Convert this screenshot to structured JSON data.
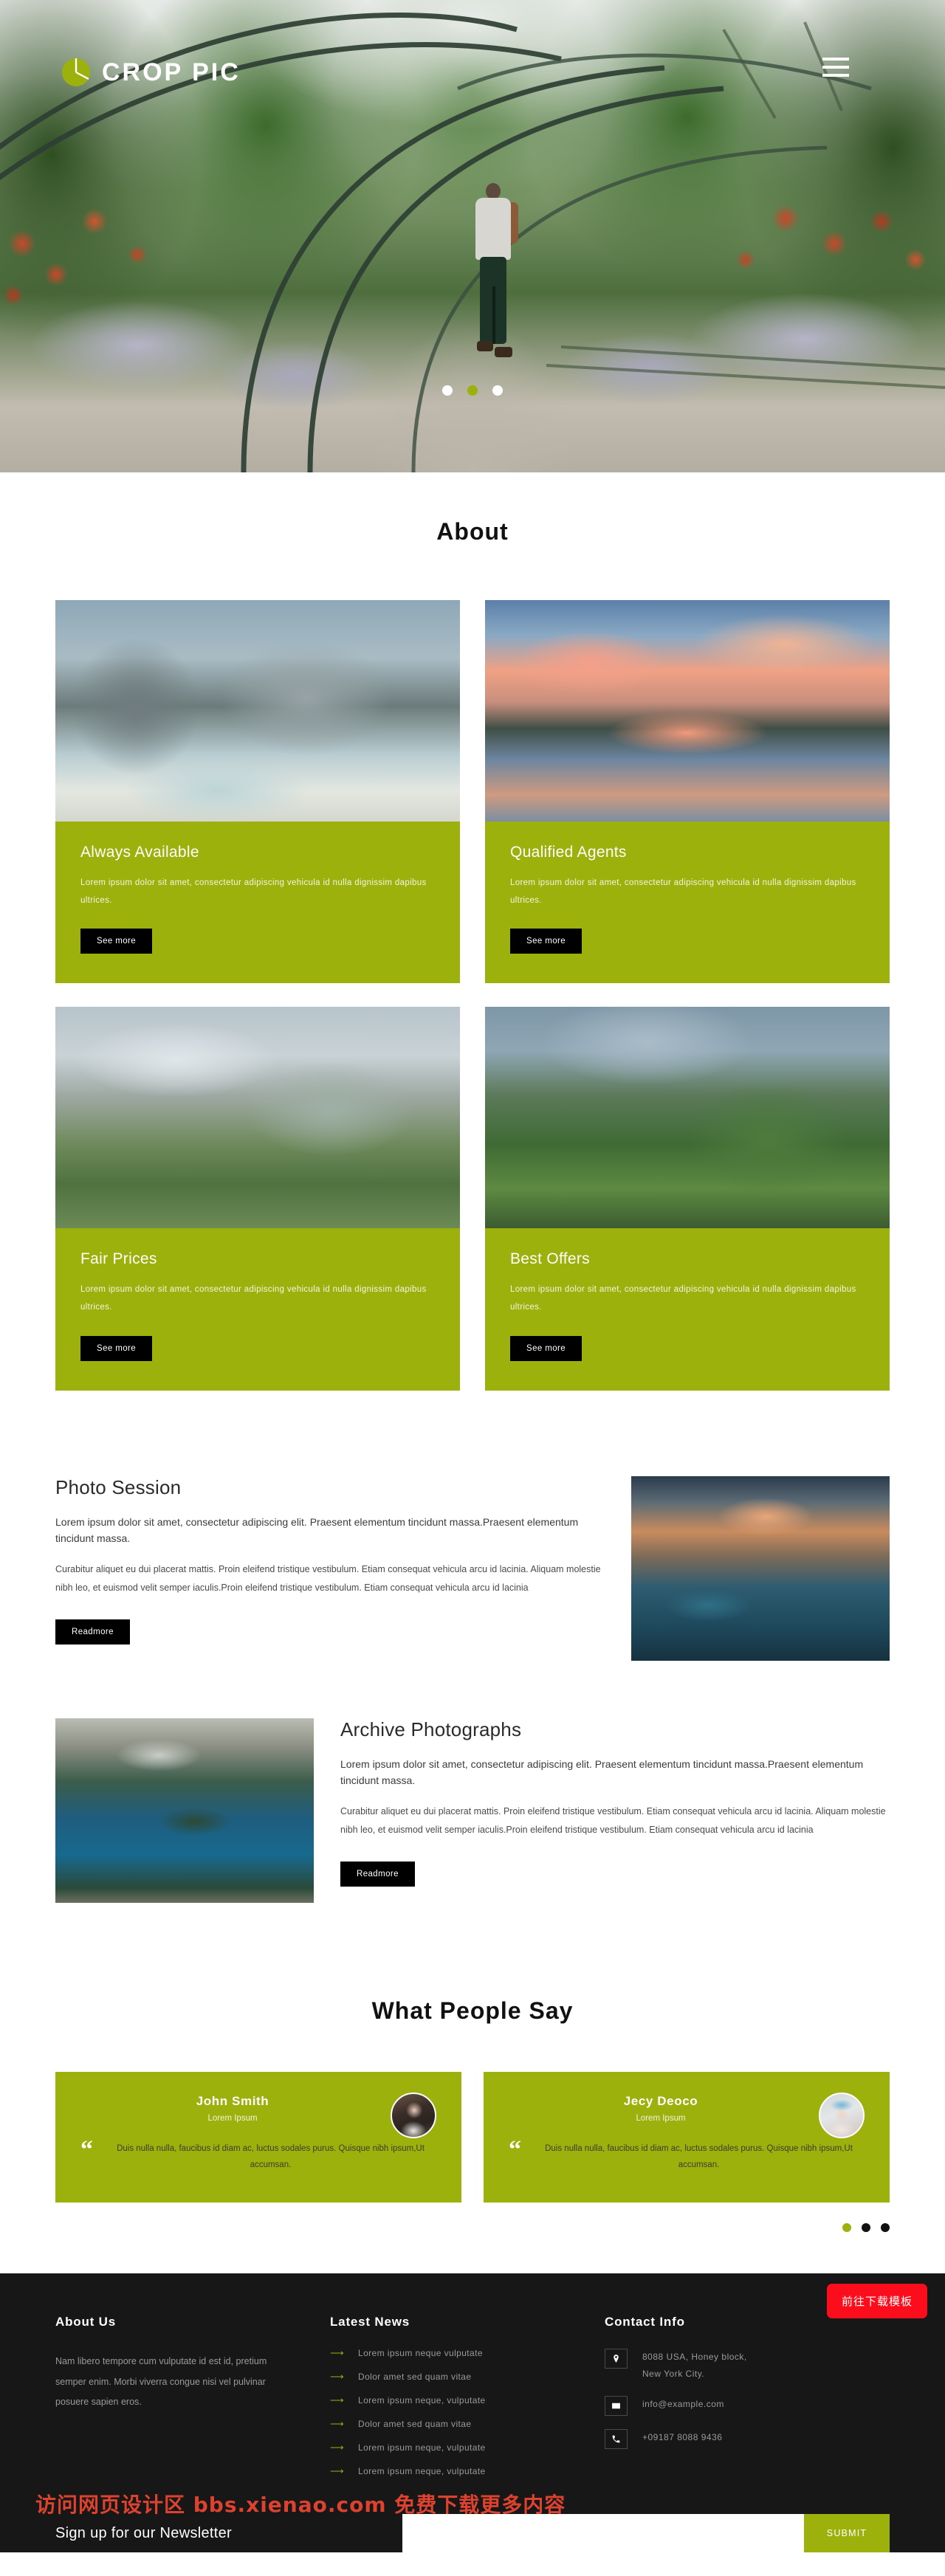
{
  "brand": {
    "name": "CROP PIC",
    "logo_icon": "pie-chart-logo-icon",
    "menu_icon": "hamburger-menu-icon"
  },
  "hero": {
    "carousel": {
      "slides": 3,
      "active_index": 1
    },
    "image_alt": "garden-pathway-with-hiker"
  },
  "about": {
    "title": "About",
    "cards": [
      {
        "title": "Always Available",
        "desc": "Lorem ipsum dolor sit amet, consectetur adipiscing vehicula id nulla dignissim dapibus ultrices.",
        "button": "See more",
        "image_alt": "mountain-lake-beach"
      },
      {
        "title": "Qualified Agents",
        "desc": "Lorem ipsum dolor sit amet, consectetur adipiscing vehicula id nulla dignissim dapibus ultrices.",
        "button": "See more",
        "image_alt": "sunset-bridge-reflection"
      },
      {
        "title": "Fair Prices",
        "desc": "Lorem ipsum dolor sit amet, consectetur adipiscing vehicula id nulla dignissim dapibus ultrices.",
        "button": "See more",
        "image_alt": "snowy-mountain-valley"
      },
      {
        "title": "Best Offers",
        "desc": "Lorem ipsum dolor sit amet, consectetur adipiscing vehicula id nulla dignissim dapibus ultrices.",
        "button": "See more",
        "image_alt": "green-mountain-ridge-hikers"
      }
    ]
  },
  "photo_session": {
    "title": "Photo Session",
    "lead": "Lorem ipsum dolor sit amet, consectetur adipiscing elit. Praesent elementum tincidunt massa.Praesent elementum tincidunt massa.",
    "body": "Curabitur aliquet eu dui placerat mattis. Proin eleifend tristique vestibulum. Etiam consequat vehicula arcu id lacinia. Aliquam molestie nibh leo, et euismod velit semper iaculis.Proin eleifend tristique vestibulum. Etiam consequat vehicula arcu id lacinia",
    "button": "Readmore",
    "image_alt": "mountain-lake-sunrise"
  },
  "archive": {
    "title": "Archive Photographs",
    "lead": "Lorem ipsum dolor sit amet, consectetur adipiscing elit. Praesent elementum tincidunt massa.Praesent elementum tincidunt massa.",
    "body": "Curabitur aliquet eu dui placerat mattis. Proin eleifend tristique vestibulum. Etiam consequat vehicula arcu id lacinia. Aliquam molestie nibh leo, et euismod velit semper iaculis.Proin eleifend tristique vestibulum. Etiam consequat vehicula arcu id lacinia",
    "button": "Readmore",
    "image_alt": "crater-lake-island"
  },
  "testimonials": {
    "title": "What People Say",
    "items": [
      {
        "name": "John Smith",
        "role": "Lorem Ipsum",
        "quote": "Duis nulla nulla, faucibus id diam ac, luctus sodales purus. Quisque nibh ipsum,Ut accumsan.",
        "avatar_alt": "woman-dark-hair-portrait"
      },
      {
        "name": "Jecy Deoco",
        "role": "Lorem Ipsum",
        "quote": "Duis nulla nulla, faucibus id diam ac, luctus sodales purus. Quisque nibh ipsum,Ut accumsan.",
        "avatar_alt": "woman-blue-beanie-portrait"
      }
    ],
    "carousel": {
      "slides": 3,
      "active_index": 0
    }
  },
  "footer": {
    "about": {
      "heading": "About Us",
      "text": "Nam libero tempore cum vulputate id est id, pretium semper enim. Morbi viverra congue nisi vel pulvinar posuere sapien eros."
    },
    "news": {
      "heading": "Latest News",
      "items": [
        "Lorem ipsum neque vulputate",
        "Dolor amet sed quam vitae",
        "Lorem ipsum neque, vulputate",
        "Dolor amet sed quam vitae",
        "Lorem ipsum neque, vulputate",
        "Lorem ipsum neque, vulputate"
      ],
      "arrow_icon": "arrow-right-icon"
    },
    "contact": {
      "heading": "Contact Info",
      "address_line1": "8088 USA, Honey block,",
      "address_line2": "New York City.",
      "email": "info@example.com",
      "phone": "+09187 8088 9436",
      "location_icon": "location-pin-icon",
      "email_icon": "envelope-icon",
      "phone_icon": "phone-icon"
    },
    "newsletter": {
      "label": "Sign up for our Newsletter",
      "placeholder": "",
      "value": "",
      "submit": "SUBMIT"
    }
  },
  "overlay": {
    "download_badge": "前往下载模板",
    "watermark": "访问网页设计区 bbs.xienao.com 免费下载更多内容"
  },
  "colors": {
    "accent_green": "#9cb10c",
    "dark": "#171717",
    "badge_red": "#fc0d1b",
    "watermark_red": "#ff4a33"
  }
}
